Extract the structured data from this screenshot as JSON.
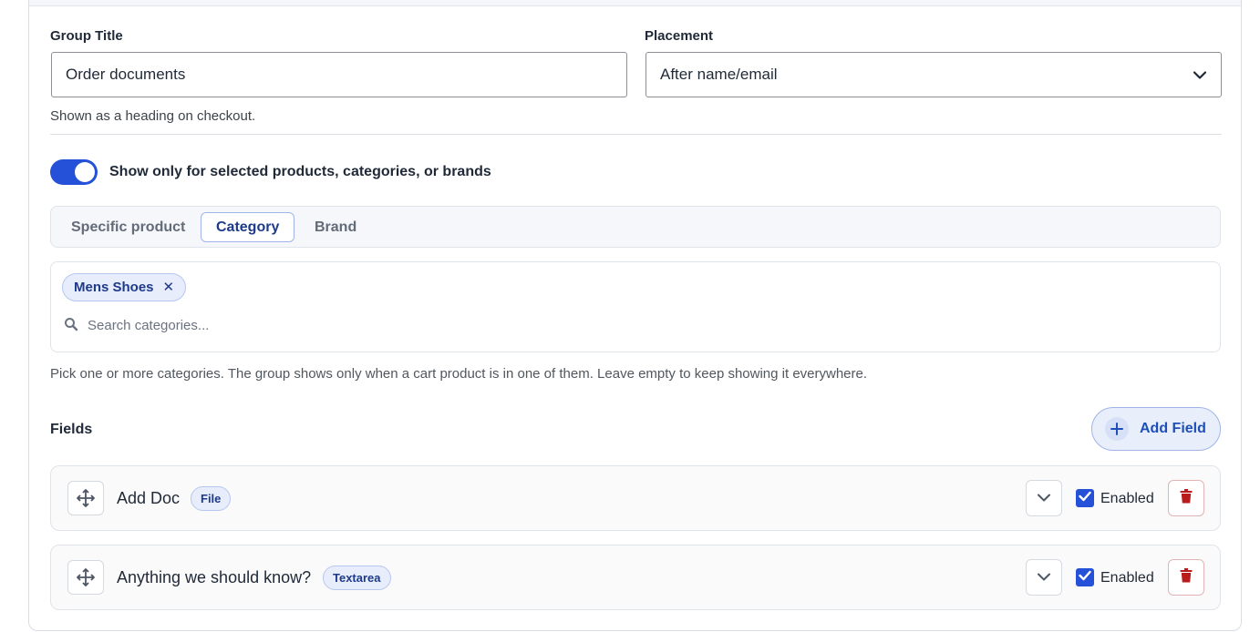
{
  "form": {
    "group_title": {
      "label": "Group Title",
      "value": "Order documents",
      "help": "Shown as a heading on checkout."
    },
    "placement": {
      "label": "Placement",
      "selected": "After name/email"
    },
    "visibility_toggle": {
      "label": "Show only for selected products, categories, or brands",
      "on": true
    },
    "scope_tabs": [
      {
        "label": "Specific product",
        "active": false
      },
      {
        "label": "Category",
        "active": true
      },
      {
        "label": "Brand",
        "active": false
      }
    ],
    "category_picker": {
      "selected_chips": [
        "Mens Shoes"
      ],
      "remove_glyph": "✕",
      "search_placeholder": "Search categories...",
      "help": "Pick one or more categories. The group shows only when a cart product is in one of them. Leave empty to keep showing it everywhere."
    }
  },
  "fields_section": {
    "label": "Fields",
    "add_button_label": "Add Field",
    "fields": [
      {
        "name": "Add Doc",
        "type": "File",
        "enabled": true,
        "enabled_label": "Enabled"
      },
      {
        "name": "Anything we should know?",
        "type": "Textarea",
        "enabled": true,
        "enabled_label": "Enabled"
      }
    ]
  },
  "icons": {
    "select": "chevron-down-icon",
    "search": "search-icon",
    "add": "plus-icon",
    "drag": "move-icon",
    "expand": "chevron-down-icon",
    "check": "check-icon",
    "delete": "trash-icon"
  },
  "colors": {
    "accent": "#2451d8",
    "chip_bg": "#e7edfb",
    "chip_text": "#1e3a8a",
    "delete": "#b91c1c"
  }
}
